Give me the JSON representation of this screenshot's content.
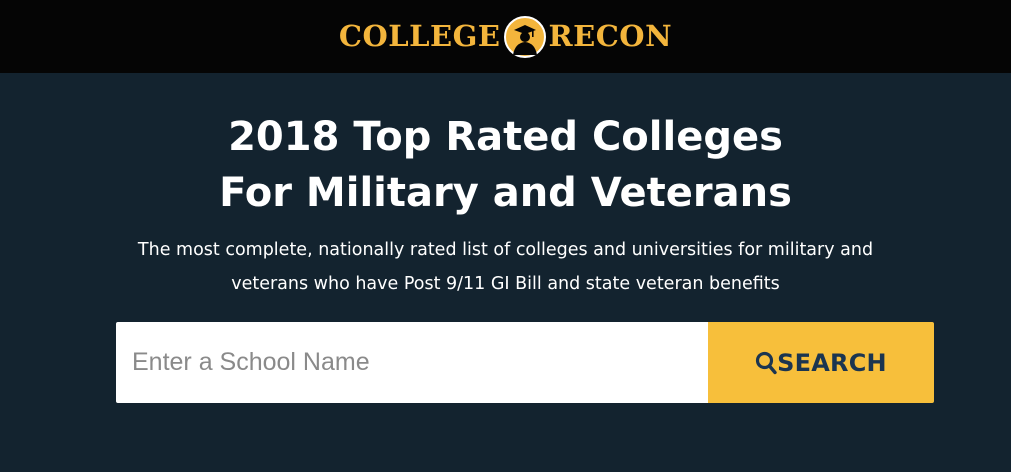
{
  "header": {
    "logo_left": "COLLEGE",
    "logo_right": "RECON",
    "logo_emblem_icon": "graduate-silhouette-icon",
    "logo_color": "#f3b53c"
  },
  "hero": {
    "headline_line1": "2018 Top Rated Colleges",
    "headline_line2": "For Military and Veterans",
    "subhead_line1": "The most complete, nationally rated list of colleges and universities for military and",
    "subhead_line2": "veterans who have Post 9/11 GI Bill and state veteran benefits"
  },
  "search": {
    "placeholder": "Enter a School Name",
    "value": "",
    "button_label": "SEARCH",
    "button_icon": "search-icon",
    "button_color": "#f7bf3b"
  },
  "colors": {
    "header_bg": "#050505",
    "hero_bg": "#13232f",
    "button_text": "#1b3550"
  }
}
